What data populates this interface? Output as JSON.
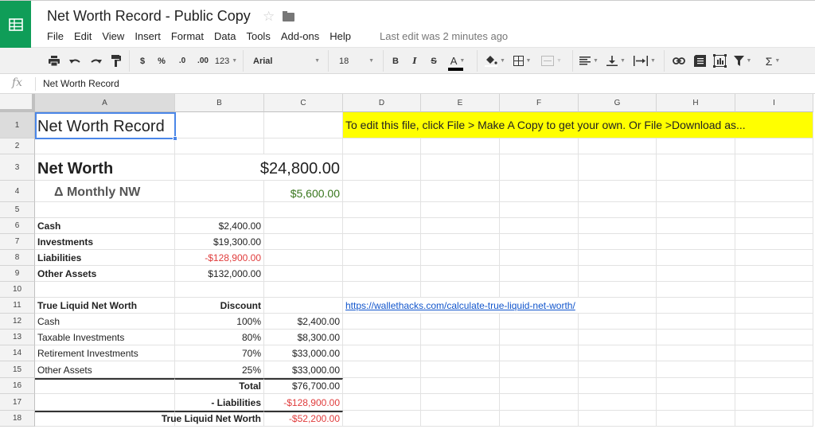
{
  "app": {
    "title": "Net Worth Record - Public Copy",
    "last_edit": "Last edit was 2 minutes ago",
    "menu": [
      "File",
      "Edit",
      "View",
      "Insert",
      "Format",
      "Data",
      "Tools",
      "Add-ons",
      "Help"
    ]
  },
  "toolbar": {
    "currency": "$",
    "percent": "%",
    "dec_decrease": ".0",
    "dec_increase": ".00",
    "more_formats": "123",
    "font": "Arial",
    "font_size": "18",
    "bold": "B",
    "italic": "I",
    "strike": "S",
    "text_color": "A",
    "sum": "Σ"
  },
  "formula_bar": {
    "fx_label": "fx",
    "value": "Net Worth Record"
  },
  "columns": [
    "A",
    "B",
    "C",
    "D",
    "E",
    "F",
    "G",
    "H",
    "I"
  ],
  "rows": [
    "1",
    "2",
    "3",
    "4",
    "5",
    "6",
    "7",
    "8",
    "9",
    "10",
    "11",
    "12",
    "13",
    "14",
    "15",
    "16",
    "17",
    "18"
  ],
  "cells": {
    "A1": "Net Worth Record",
    "D1": "To edit this file, click File > Make A Copy to get your own. Or File >Download as...",
    "A3": "Net Worth",
    "C3": "$24,800.00",
    "A4": "Δ Monthly NW",
    "C4": "$5,600.00",
    "A6": "Cash",
    "B6": "$2,400.00",
    "A7": "Investments",
    "B7": "$19,300.00",
    "A8": "Liabilities",
    "B8": "-$128,900.00",
    "A9": "Other Assets",
    "B9": "$132,000.00",
    "A11": "True Liquid Net Worth",
    "B11": "Discount",
    "D11": "https://wallethacks.com/calculate-true-liquid-net-worth/",
    "A12": "Cash",
    "B12": "100%",
    "C12": "$2,400.00",
    "A13": "Taxable Investments",
    "B13": "80%",
    "C13": "$8,300.00",
    "A14": "Retirement Investments",
    "B14": "70%",
    "C14": "$33,000.00",
    "A15": "Other Assets",
    "B15": "25%",
    "C15": "$33,000.00",
    "B16": "Total",
    "C16": "$76,700.00",
    "B17": "- Liabilities",
    "C17": "-$128,900.00",
    "B18": "True Liquid Net Worth",
    "C18": "-$52,200.00"
  },
  "selected_cell": "A1",
  "colors": {
    "brand": "#0f9d58",
    "highlight": "#ffff00",
    "negative": "#e03c3c",
    "positive": "#38761d",
    "link": "#1155cc",
    "selection": "#4a86e8"
  }
}
